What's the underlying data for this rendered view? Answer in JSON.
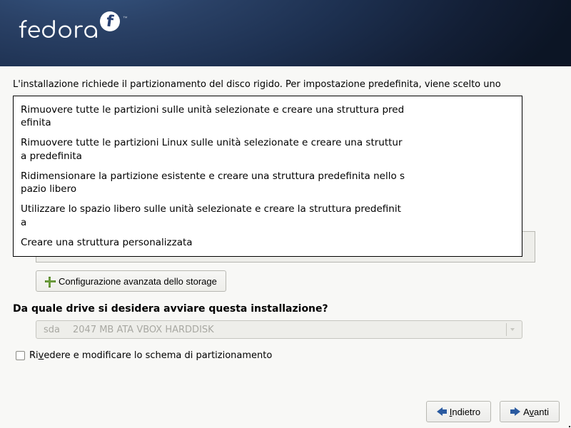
{
  "brand": {
    "name": "fedora",
    "tm": "™"
  },
  "intro": "L'installazione richiede il partizionamento del disco rigido.  Per impostazione predefinita, viene scelto uno",
  "partition_options": [
    "Rimuovere tutte le partizioni sulle unità selezionate e creare una struttura predefinita",
    "Rimuovere tutte le partizioni Linux sulle unità selezionate e creare una struttura predefinita",
    "Ridimensionare la partizione esistente e creare una struttura predefinita nello spazio libero",
    "Utilizzare lo spazio libero sulle unità selezionate e creare la struttura predefinita",
    "Creare una struttura personalizzata"
  ],
  "advanced_storage_label": "Configurazione avanzata dello storage",
  "drive_question": "Da quale drive si desidera avviare questa installazione?",
  "drive_select": {
    "device": "sda",
    "descr": "2047 MB ATA VBOX HARDDISK"
  },
  "review_label": {
    "pre": "Ri",
    "ul": "v",
    "post": "edere e modificare lo schema di partizionamento"
  },
  "buttons": {
    "back": {
      "ul": "I",
      "post": "ndietro"
    },
    "next": {
      "pre": "A",
      "ul": "v",
      "post": "anti"
    }
  }
}
